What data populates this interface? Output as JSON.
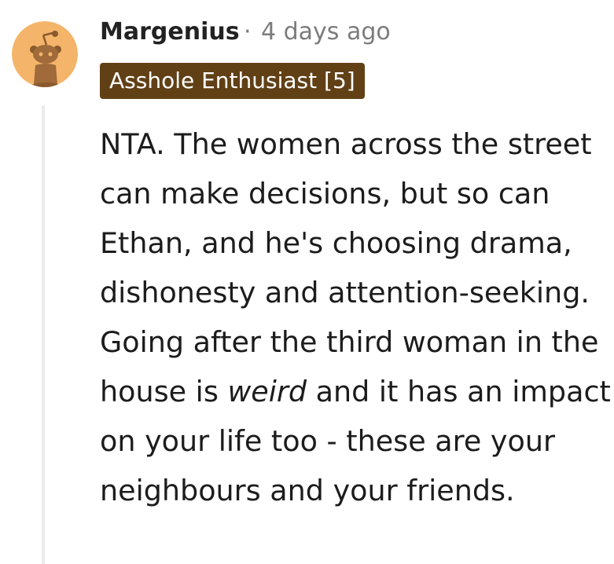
{
  "comment": {
    "author": "Margenius",
    "separator": "·",
    "timestamp": "4 days ago",
    "flair": "Asshole Enthusiast [5]",
    "body": {
      "part1": "NTA. The women across the street can make decisions, but so can Ethan, and he's choosing drama, dishonesty and attention-seeking. Going after the third woman in the house is ",
      "emphasis": "weird",
      "part2": " and it has an impact on your life too - these are your neighbours and your friends."
    }
  },
  "colors": {
    "avatar_background": "#F4B56A",
    "flair_background": "#614016",
    "thread_line": "#ECECEC",
    "meta_text": "#7C7C7C"
  },
  "icons": {
    "avatar": "snoo-avatar-icon"
  }
}
